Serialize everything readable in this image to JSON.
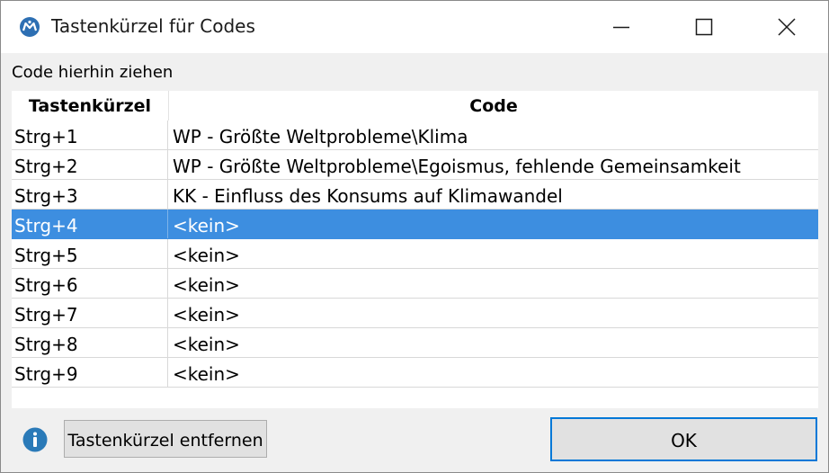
{
  "window": {
    "title": "Tastenkürzel für Codes"
  },
  "icons": {
    "app": "maxqda-logo-icon",
    "minimize": "minimize-icon",
    "maximize": "maximize-icon",
    "close": "close-icon",
    "info": "info-icon"
  },
  "colors": {
    "selection": "#3d8ee0",
    "accent": "#0078d7",
    "info": "#2a7ab8"
  },
  "drop_hint": "Code hierhin ziehen",
  "table": {
    "headers": {
      "shortcut": "Tastenkürzel",
      "code": "Code"
    },
    "selected_index": 3,
    "rows": [
      {
        "shortcut": "Strg+1",
        "code": "WP - Größte Weltprobleme\\Klima"
      },
      {
        "shortcut": "Strg+2",
        "code": "WP - Größte Weltprobleme\\Egoismus, fehlende Gemeinsamkeit"
      },
      {
        "shortcut": "Strg+3",
        "code": "KK - Einfluss des Konsums auf Klimawandel"
      },
      {
        "shortcut": "Strg+4",
        "code": "<kein>"
      },
      {
        "shortcut": "Strg+5",
        "code": "<kein>"
      },
      {
        "shortcut": "Strg+6",
        "code": "<kein>"
      },
      {
        "shortcut": "Strg+7",
        "code": "<kein>"
      },
      {
        "shortcut": "Strg+8",
        "code": "<kein>"
      },
      {
        "shortcut": "Strg+9",
        "code": "<kein>"
      }
    ]
  },
  "buttons": {
    "remove_label": "Tastenkürzel entfernen",
    "ok_label": "OK"
  }
}
